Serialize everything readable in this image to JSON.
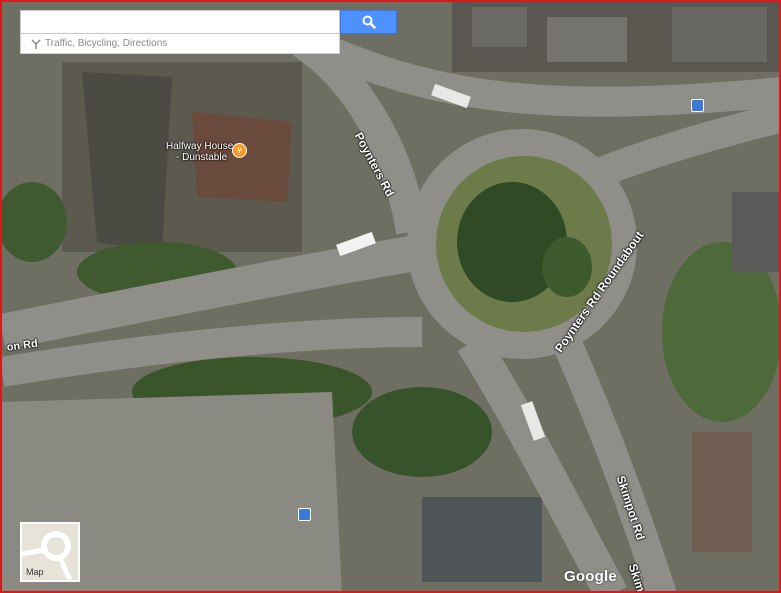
{
  "search": {
    "placeholder": "",
    "button_icon": "search-icon",
    "hint": "Traffic, Bicycling, Directions",
    "hint_icon": "directions-icon"
  },
  "map": {
    "type": "satellite",
    "road_labels": {
      "poynters_rd": "Poynters Rd",
      "roundabout": "Poynters Rd Roundabout",
      "on_rd": "on Rd",
      "skimpot_rd": "Skimpot Rd",
      "skimpot_rd_cut": "Skim"
    },
    "poi": {
      "name_line1": "Halfway House",
      "name_line2": "- Dunstable",
      "icon": "restaurant-icon"
    },
    "transit_icons": [
      "bus-stop-icon",
      "bus-stop-icon"
    ]
  },
  "minimap": {
    "label": "Map"
  },
  "attribution": {
    "logo": "Google"
  },
  "colors": {
    "frame": "#d21d1d",
    "search_button": "#4d90fe",
    "poi": "#f39a29",
    "bus": "#3b7ad9"
  }
}
